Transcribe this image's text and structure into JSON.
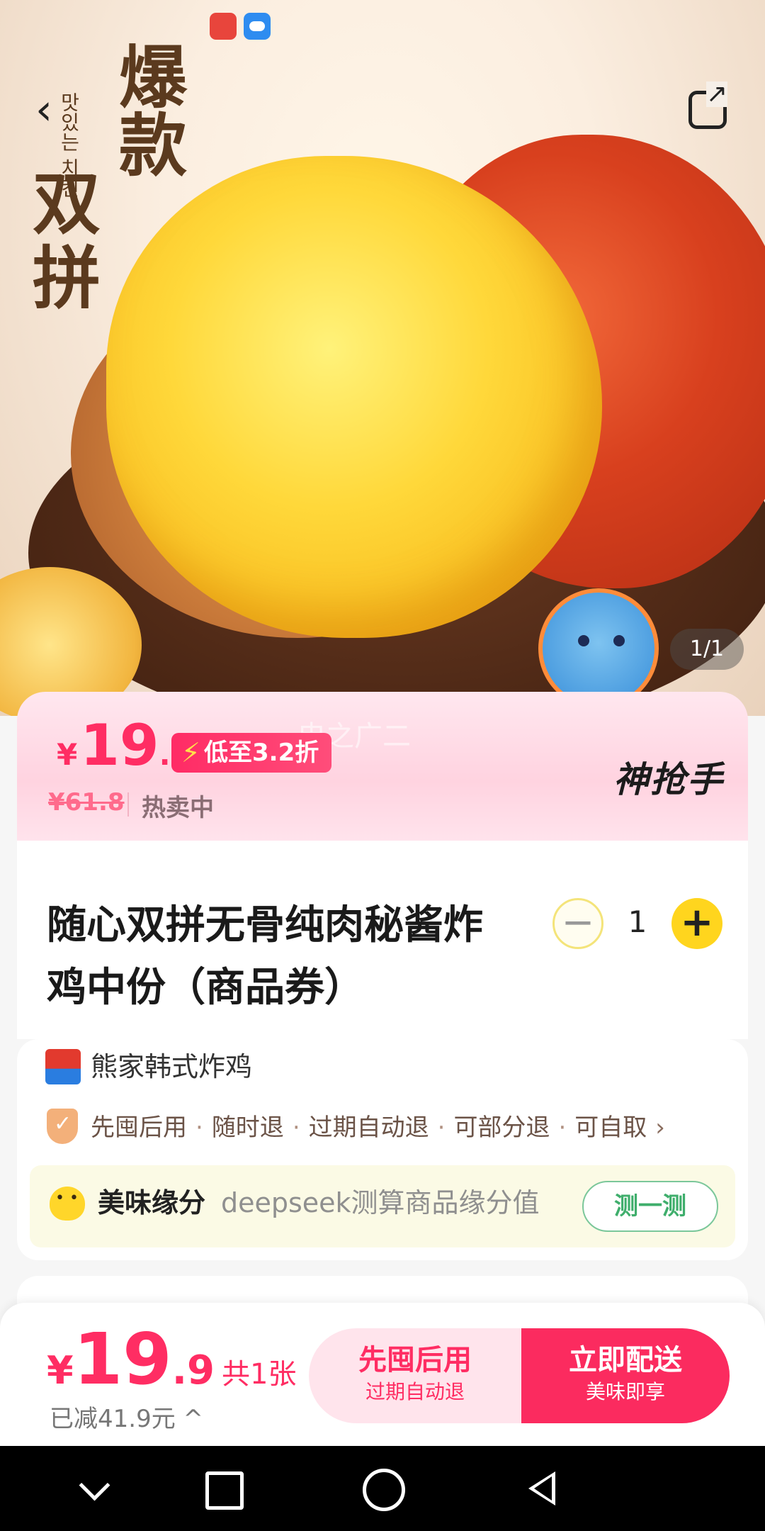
{
  "hero": {
    "promo_line1": "爆款",
    "promo_line2": "双拼",
    "korean_text": "맛있는 치킨",
    "pager": "1/1"
  },
  "watermark": "电之广二",
  "price_banner": {
    "currency": "¥",
    "price_int": "19",
    "price_dec": ".9",
    "discount_tag": "低至3.2折",
    "original_price": "¥61.8",
    "status": "热卖中",
    "brand_logo": "神抢手"
  },
  "product": {
    "title": "随心双拼无骨纯肉秘酱炸鸡中份（商品券）",
    "quantity": "1",
    "minus": "−",
    "plus": "+"
  },
  "store": {
    "name": "熊家韩式炸鸡",
    "guarantees": [
      "先囤后用",
      "随时退",
      "过期自动退",
      "可部分退",
      "可自取"
    ],
    "separator": "·",
    "chevron": "›"
  },
  "fate": {
    "title": "美味缘分",
    "desc": "deepseek测算商品缘分值",
    "button": "测一测"
  },
  "bottom_bar": {
    "currency": "¥",
    "price_int": "19",
    "price_dec": ".9",
    "count": "共1张",
    "saved": "已减41.9元 ^",
    "left_action_title": "先囤后用",
    "left_action_sub": "过期自动退",
    "right_action_title": "立即配送",
    "right_action_sub": "美味即享"
  },
  "colors": {
    "accent": "#ff2d63",
    "primary_button": "#fb2b5f",
    "qty_plus": "#ffd51e",
    "fate_button": "#3fae6c"
  },
  "icons": {
    "back": "back-arrow-icon",
    "share": "share-icon",
    "shield": "shield-check-icon",
    "heart": "heart-face-icon",
    "nav": [
      "nav-down-icon",
      "recent-apps-icon",
      "home-icon",
      "back-triangle-icon"
    ]
  }
}
